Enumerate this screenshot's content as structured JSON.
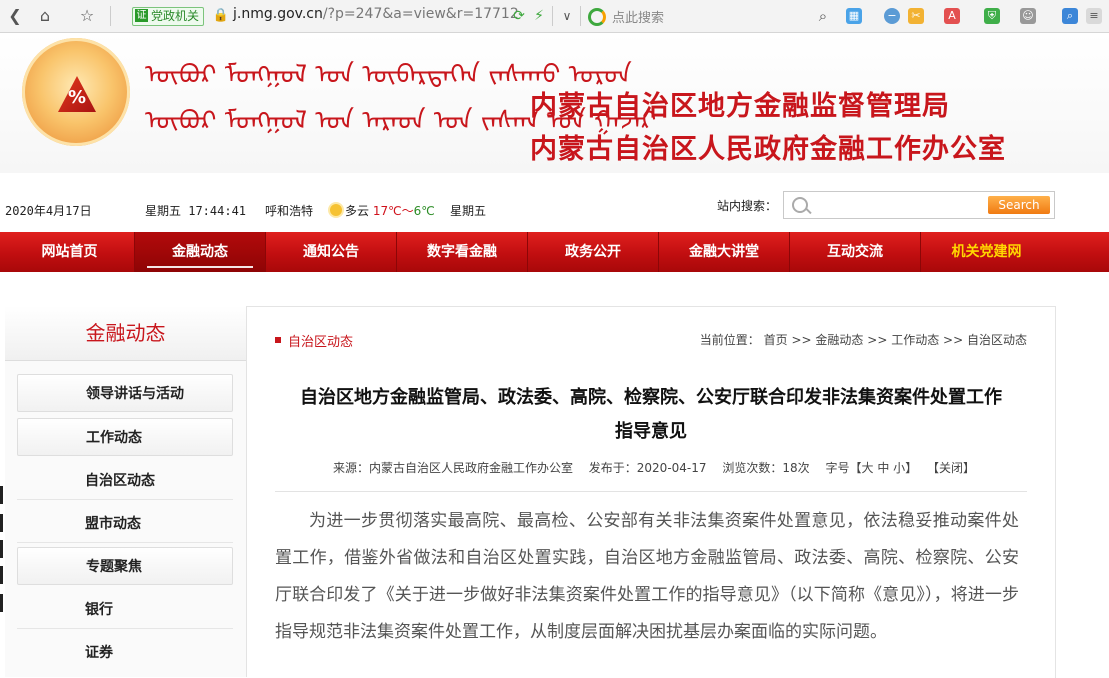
{
  "browser": {
    "url_prefix": "j.nmg.gov.cn",
    "url_rest": "/?p=247&a=view&r=17712",
    "badge": "党政机关",
    "search_placeholder": "点此搜索"
  },
  "banner": {
    "mongolian_line1": "ᠦᠪᠦᠷ ᠮᠣᠩᠭᠣᠯ ᠤᠨ ᠥᠪᠡᠷᠲᠡᠭᠡᠨ ᠵᠠᠰᠠᠬᠤ ᠣᠷᠣᠨ",
    "mongolian_line2": "ᠦᠪᠦᠷ ᠮᠣᠩᠭᠣᠯ ᠤᠨ ᠠᠷᠠᠳ ᠤᠨ ᠵᠠᠰᠠᠭ ᠤᠨ ᠭᠠᠵᠠᠷ",
    "title1": "内蒙古自治区地方金融监督管理局",
    "title2": "内蒙古自治区人民政府金融工作办公室"
  },
  "info": {
    "date": "2020年4月17日",
    "weekday_time": "星期五 17:44:41",
    "city": "呼和浩特",
    "weather": "多云",
    "temp_high": "17℃",
    "temp_sep": "～",
    "temp_low": "6℃",
    "weekday": "星期五",
    "search_label": "站内搜索：",
    "search_button": "Search"
  },
  "nav": [
    "网站首页",
    "金融动态",
    "通知公告",
    "数字看金融",
    "政务公开",
    "金融大讲堂",
    "互动交流",
    "机关党建网"
  ],
  "sidebar": {
    "title": "金融动态",
    "items": [
      "领导讲话与活动",
      "工作动态",
      "自治区动态",
      "盟市动态",
      "专题聚焦",
      "银行",
      "证券"
    ]
  },
  "article": {
    "section": "自治区动态",
    "location_label": "当前位置：",
    "crumbs": [
      "首页",
      "金融动态",
      "工作动态",
      "自治区动态"
    ],
    "crumb_sep": ">>",
    "title_line1": "自治区地方金融监管局、政法委、高院、检察院、公安厅联合印发非法集资案件处置工作",
    "title_line2": "指导意见",
    "source": "来源：内蒙古自治区人民政府金融工作办公室",
    "published": "发布于：2020-04-17",
    "views": "浏览次数：18次",
    "font_size_label": "字号【",
    "font_large": "大",
    "font_medium": "中",
    "font_small": "小",
    "font_size_end": "】",
    "close": "【关闭】",
    "body": "为进一步贯彻落实最高院、最高检、公安部有关非法集资案件处置意见，依法稳妥推动案件处置工作，借鉴外省做法和自治区处置实践，自治区地方金融监管局、政法委、高院、检察院、公安厅联合印发了《关于进一步做好非法集资案件处置工作的指导意见》（以下简称《意见》），将进一步指导规范非法集资案件处置工作，从制度层面解决困扰基层办案面临的实际问题。"
  }
}
